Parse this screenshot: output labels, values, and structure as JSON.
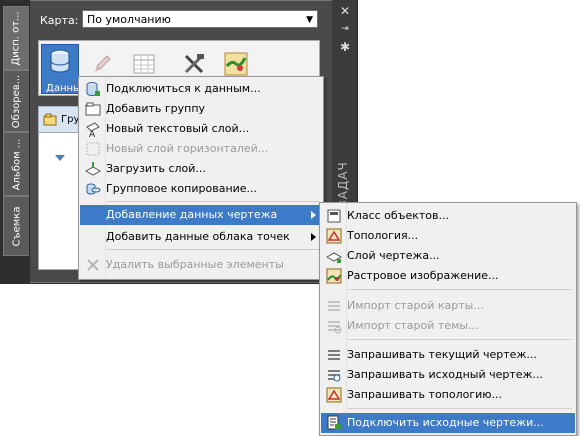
{
  "side_tabs": [
    "Дисп. от...",
    "Обзорев...",
    "Альбом ...",
    "Съемка"
  ],
  "right_strip": {
    "title": "ЗАДАЧ"
  },
  "map": {
    "label": "Карта:",
    "value": "По умолчанию"
  },
  "toolbar": {
    "data_label": "Данны"
  },
  "subtab": {
    "label": "Гру"
  },
  "main_menu": {
    "items": [
      {
        "label": "Подключиться к данным...",
        "icon": "database-connect-icon",
        "disabled": false
      },
      {
        "label": "Добавить группу",
        "icon": "folder-icon",
        "disabled": false
      },
      {
        "label": "Новый текстовый слой...",
        "icon": "text-layer-icon",
        "disabled": false
      },
      {
        "label": "Новый слой горизонталей...",
        "icon": "contour-layer-icon",
        "disabled": true
      },
      {
        "label": "Загрузить слой...",
        "icon": "load-layer-icon",
        "disabled": false
      },
      {
        "label": "Групповое копирование...",
        "icon": "bulk-copy-icon",
        "disabled": false
      },
      {
        "label": "Добавление данных чертежа",
        "submenu": true,
        "highlighted": true
      },
      {
        "label": "Добавить данные облака точек",
        "submenu": true
      },
      {
        "label": "Удалить выбранные элементы",
        "icon": "delete-icon",
        "disabled": true
      }
    ]
  },
  "sub_menu": {
    "items": [
      {
        "label": "Класс объектов...",
        "icon": "object-class-icon"
      },
      {
        "label": "Топология...",
        "icon": "topology-icon"
      },
      {
        "label": "Слой чертежа...",
        "icon": "drawing-layer-icon"
      },
      {
        "label": "Растровое изображение...",
        "icon": "raster-image-icon"
      },
      {
        "label": "Импорт старой карты...",
        "icon": "import-map-icon",
        "disabled": true
      },
      {
        "label": "Импорт старой темы...",
        "icon": "import-theme-icon",
        "disabled": true
      },
      {
        "label": "Запрашивать текущий чертеж...",
        "icon": "query-current-icon"
      },
      {
        "label": "Запрашивать исходный чертеж...",
        "icon": "query-source-icon"
      },
      {
        "label": "Запрашивать топологию...",
        "icon": "query-topology-icon"
      },
      {
        "label": "Подключить исходные чертежи...",
        "icon": "attach-drawings-icon",
        "highlighted": true
      }
    ]
  }
}
